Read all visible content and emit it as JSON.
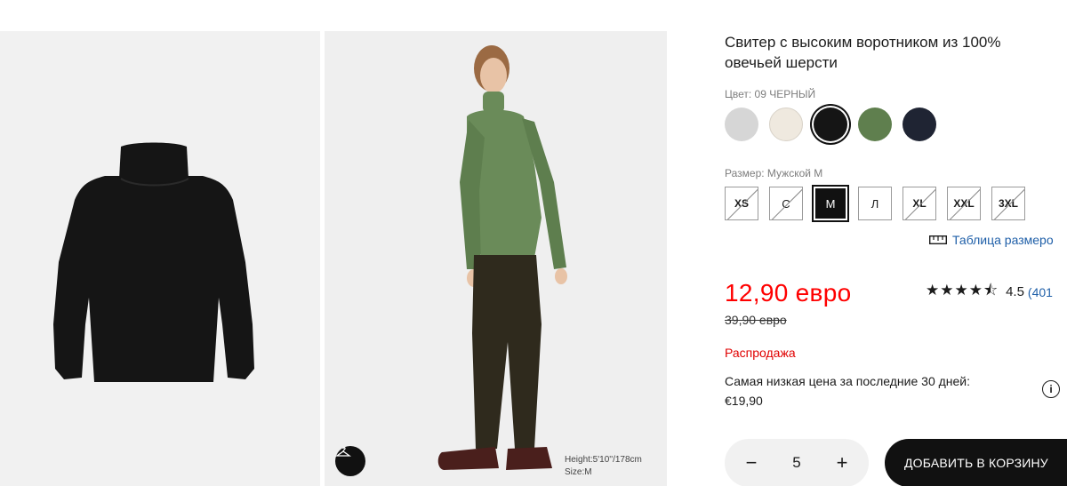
{
  "product": {
    "title": "Свитер с высоким воротником из 100% овечьей шерсти",
    "color_label": "Цвет: 09 ЧЕРНЫЙ",
    "size_label": "Размер: Мужской M",
    "colors": [
      {
        "name": "light gray",
        "hex": "#d6d6d6",
        "selected": false
      },
      {
        "name": "off white",
        "hex": "#efe9df",
        "selected": false
      },
      {
        "name": "09 black",
        "hex": "#151515",
        "selected": true
      },
      {
        "name": "olive",
        "hex": "#5f7f4e",
        "selected": false
      },
      {
        "name": "navy",
        "hex": "#1f2433",
        "selected": false
      }
    ],
    "sizes": [
      "XS",
      "С",
      "M",
      "Л",
      "XL",
      "XXL",
      "3XL"
    ],
    "size_chart_link": "Таблица размеро",
    "price": "12,90 евро",
    "old_price": "39,90 евро",
    "rating_value": "4.5",
    "rating_count": "(401",
    "rating_stars": 4.5,
    "sale_label": "Распродажа",
    "lowest_price_text": "Самая низкая цена за последние 30 дней:",
    "lowest_price_value": "€19,90",
    "info_icon": "i",
    "quantity": "5",
    "qty_minus": "−",
    "qty_plus": "+",
    "add_to_cart": "ДОБАВИТЬ В КОРЗИНУ"
  },
  "images": {
    "model_height": "Height:5'10''/178cm",
    "model_size": "Size:M",
    "hanger_icon": "hanger-icon"
  },
  "colors": {
    "sale_red": "#ff0000",
    "link_blue": "#1f5fa8",
    "button_black": "#111111"
  }
}
